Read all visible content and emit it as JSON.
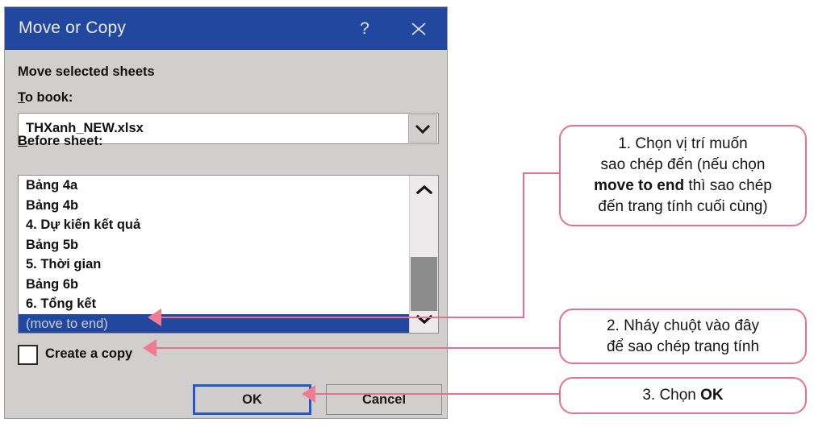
{
  "dialog": {
    "title": "Move or Copy",
    "help_icon": "?",
    "close_icon": "close-icon",
    "labels": {
      "move_selected_sheets": "Move selected sheets",
      "to_book_accel": "T",
      "to_book_rest": "o book:",
      "before_sheet_accel": "B",
      "before_sheet_rest": "efore sheet:"
    },
    "combo": {
      "value": "THXanh_NEW.xlsx",
      "arrow_icon": "chevron-down-icon"
    },
    "list": {
      "items": [
        "Bảng 4a",
        "Bảng 4b",
        "4. Dự kiến kết quả",
        "Bảng 5b",
        "5. Thời gian",
        "Bảng 6b",
        "6. Tổng kết",
        "(move to end)"
      ],
      "selected_index": 7,
      "scroll_up_icon": "chevron-up-icon",
      "scroll_down_icon": "chevron-down-icon"
    },
    "checkbox": {
      "accel": "C",
      "rest": "reate a copy",
      "checked": false
    },
    "buttons": {
      "ok": "OK",
      "cancel": "Cancel"
    },
    "colors": {
      "titlebar": "#21479e",
      "body": "#d0cfcd",
      "selection": "#21479e",
      "focus_border": "#2458c6"
    }
  },
  "callouts": {
    "accent_color": "#e8708f",
    "arrow_color": "#f07b94",
    "one": {
      "line1": "1. Chọn vị trí muốn",
      "line2": "sao chép đến (nếu chọn",
      "line3_bold": "move to end",
      "line3_rest": " thì sao chép",
      "line4": "đến trang tính cuối cùng)"
    },
    "two": {
      "line1": "2. Nháy chuột vào đây",
      "line2": "để sao chép trang tính"
    },
    "three": {
      "prefix": "3. Chọn ",
      "bold": "OK"
    }
  }
}
